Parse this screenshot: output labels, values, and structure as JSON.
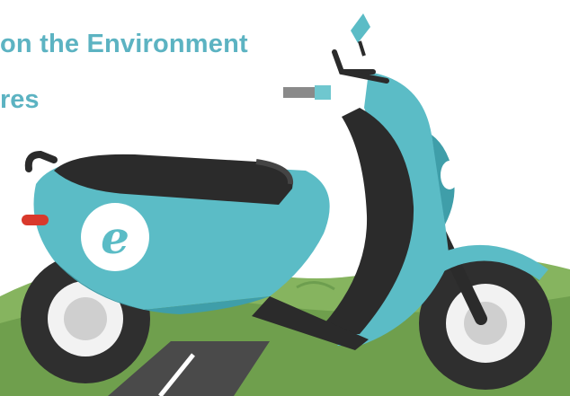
{
  "headline": "on the Environment",
  "subline": "res",
  "emblem_letter": "e",
  "colors": {
    "scooter_body": "#5bbcc6",
    "scooter_shadow": "#3f9ea9",
    "seat": "#2b2b2b",
    "hill_green": "#7fae5a",
    "hill_dark": "#5e8f45",
    "road": "#4a4a4a",
    "road_line": "#ffffff",
    "text": "#5cb3c2",
    "tail_light": "#d9392c"
  },
  "icons": [
    "scooter-illustration",
    "e-logo-icon"
  ]
}
